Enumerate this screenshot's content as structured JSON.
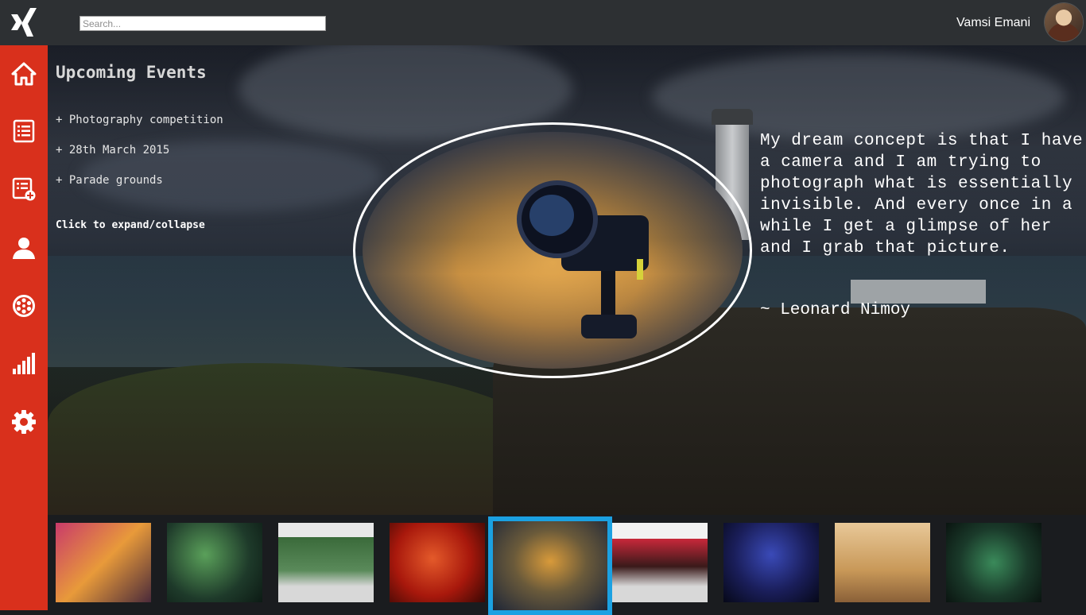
{
  "header": {
    "logo_icon": "xing-logo-icon",
    "search": {
      "placeholder": "Search...",
      "value": ""
    },
    "user_name": "Vamsi Emani"
  },
  "sidebar": {
    "items": [
      {
        "icon": "home-icon"
      },
      {
        "icon": "list-icon"
      },
      {
        "icon": "add-list-icon"
      },
      {
        "icon": "user-icon"
      },
      {
        "icon": "film-reel-icon"
      },
      {
        "icon": "signal-bars-icon"
      },
      {
        "icon": "gear-icon"
      }
    ],
    "color": "#d9301c"
  },
  "events": {
    "title": "Upcoming Events",
    "items": [
      "+ Photography competition",
      "+ 28th March 2015",
      "+ Parade grounds"
    ],
    "toggle_hint": "Click to expand/collapse"
  },
  "quote": {
    "text": "My dream concept is that I have a camera and I am trying to photograph what is essentially invisible. And every once in a while I get a glimpse of her and I grab that picture.",
    "author": "~ Leonard Nimoy"
  },
  "thumbnails": {
    "selected_index": 4,
    "selected_color": "#1ba1e2",
    "items": [
      {
        "name": "dance-performance-thumb"
      },
      {
        "name": "guitar-concert-thumb"
      },
      {
        "name": "breakdance-thumb"
      },
      {
        "name": "red-stage-dance-thumb"
      },
      {
        "name": "camera-lens-thumb"
      },
      {
        "name": "drama-performance-thumb"
      },
      {
        "name": "drummer-thumb"
      },
      {
        "name": "chess-thumb"
      },
      {
        "name": "group-masks-thumb"
      }
    ]
  }
}
